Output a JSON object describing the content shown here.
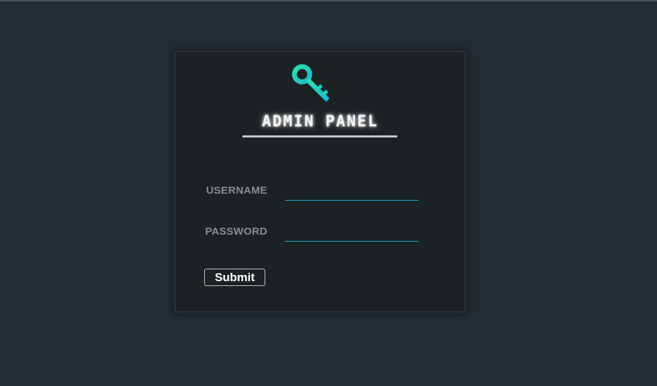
{
  "panel": {
    "title": "ADMIN PANEL",
    "icon": "key-icon",
    "username_label": "USERNAME",
    "password_label": "PASSWORD",
    "username_value": "",
    "password_value": "",
    "submit_label": "Submit"
  },
  "colors": {
    "background": "#222d32",
    "panel": "#1c2124",
    "accent": "#1fa7d6",
    "key_gradient_start": "#2ee0a8",
    "key_gradient_end": "#1ab8d4"
  }
}
